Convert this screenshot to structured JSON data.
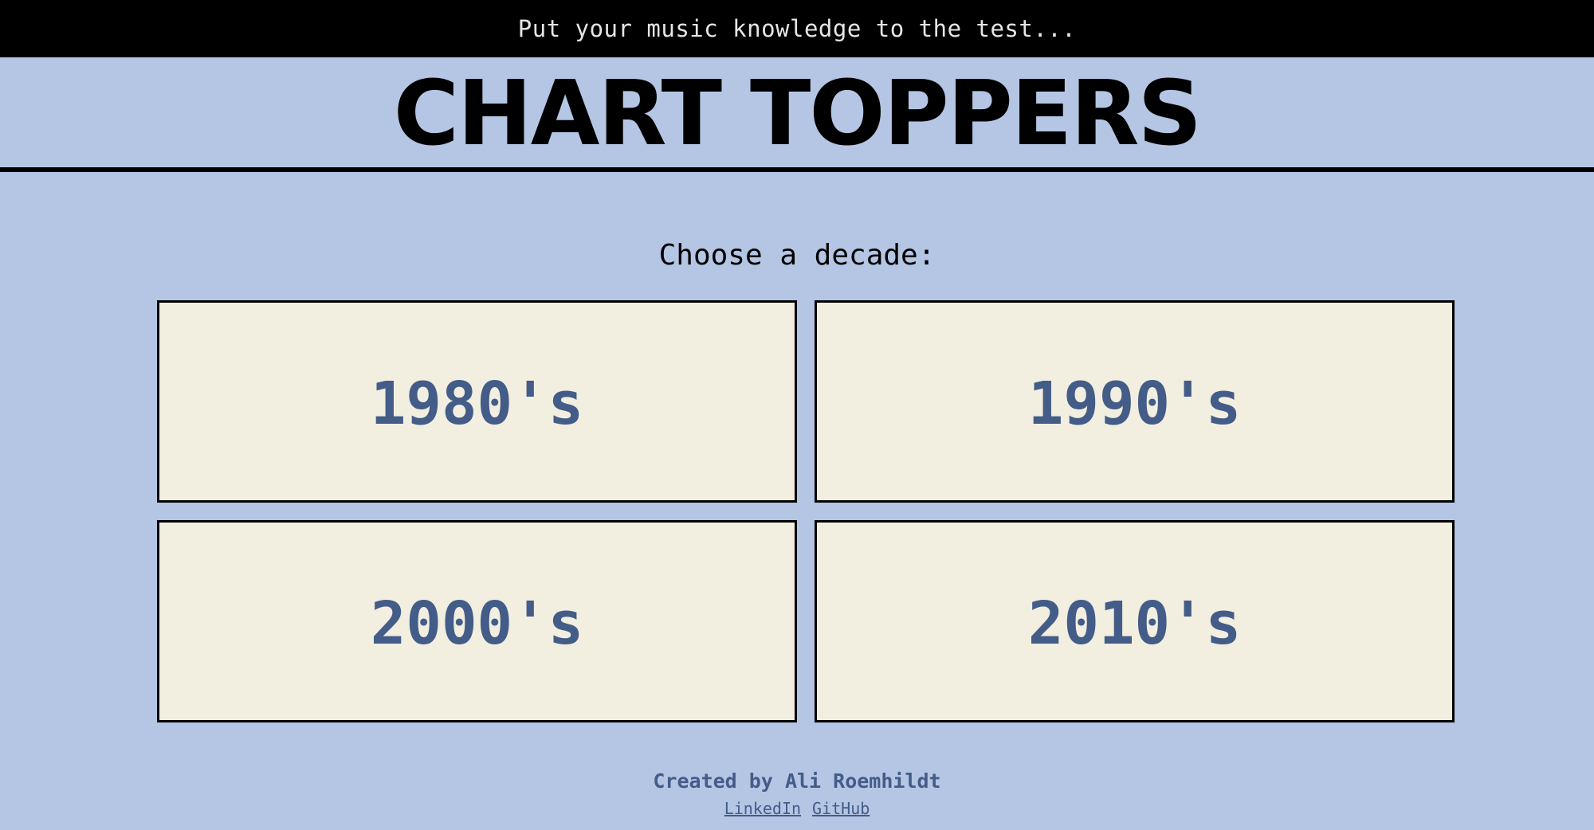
{
  "header": {
    "tagline": "Put your music knowledge to the test...",
    "title": "CHART TOPPERS"
  },
  "main": {
    "prompt": "Choose a decade:",
    "decades": [
      {
        "label": "1980's"
      },
      {
        "label": "1990's"
      },
      {
        "label": "2000's"
      },
      {
        "label": "2010's"
      }
    ]
  },
  "footer": {
    "credit": "Created by Ali Roemhildt",
    "links": [
      {
        "label": "LinkedIn"
      },
      {
        "label": "GitHub"
      }
    ]
  },
  "colors": {
    "background": "#b4c6e4",
    "topbar": "#000000",
    "card": "#f2eee0",
    "accent": "#435c88"
  }
}
